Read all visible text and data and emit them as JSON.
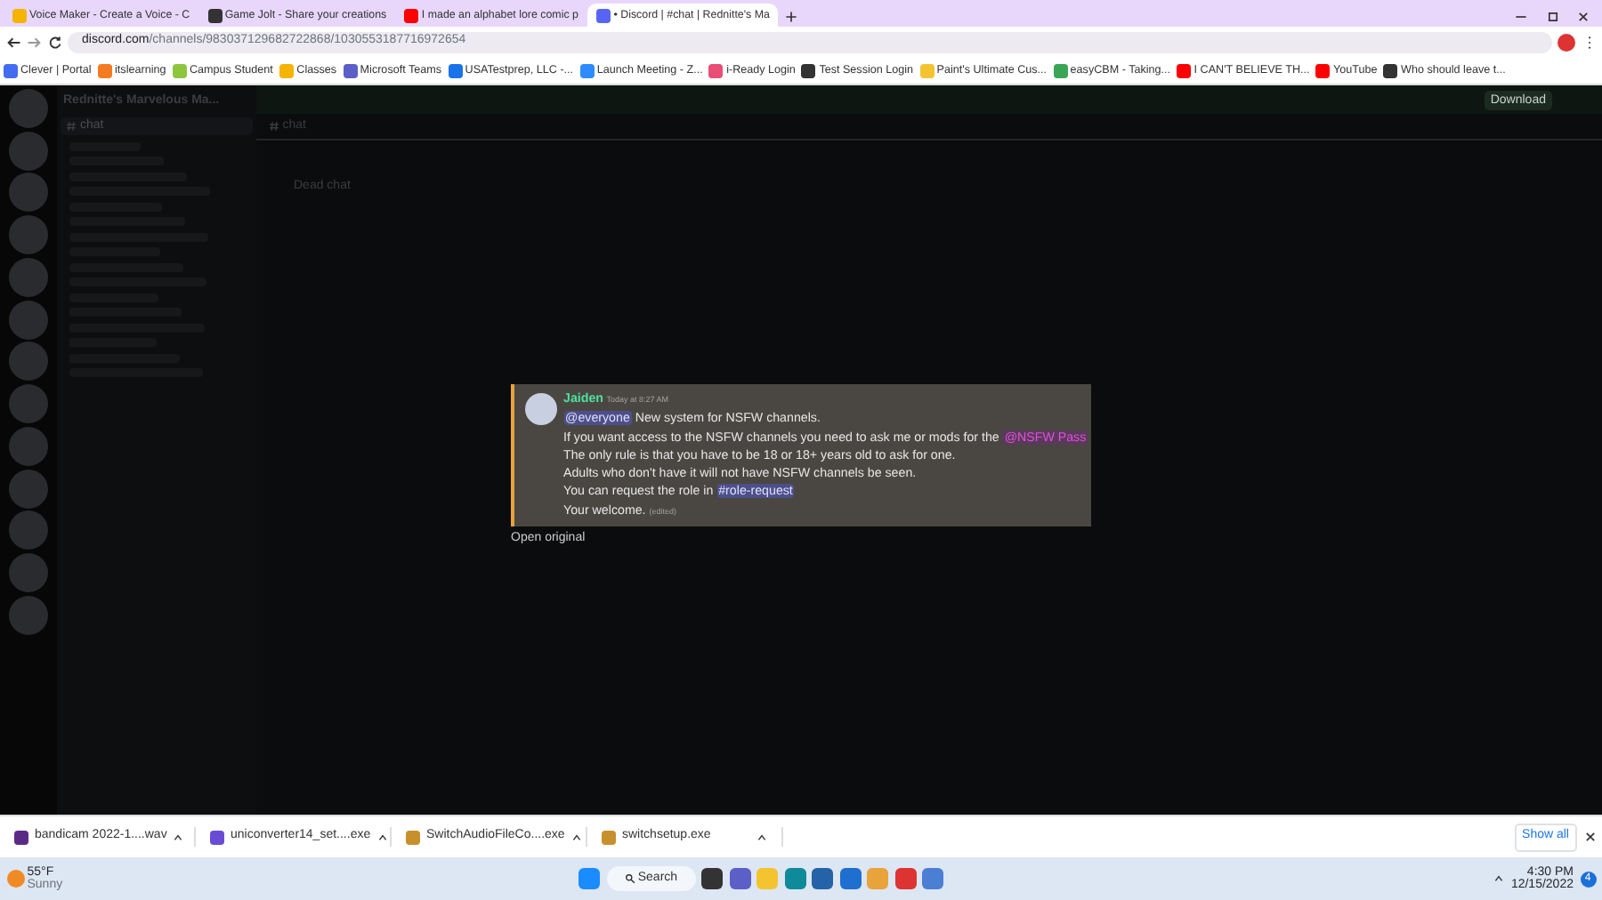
{
  "tabs": [
    {
      "title": "Voice Maker - Create a Voice - C",
      "selected": false,
      "color": "#f4b400"
    },
    {
      "title": "Game Jolt - Share your creations",
      "selected": false,
      "color": "#333333"
    },
    {
      "title": "I made an alphabet lore comic p",
      "selected": false,
      "color": "#ff0000"
    },
    {
      "title": "• Discord | #chat | Rednitte's Ma",
      "selected": true,
      "color": "#5865f2"
    }
  ],
  "address": {
    "host": "discord.com",
    "path": "/channels/983037129682722868/1030553187716972654"
  },
  "bookmarks": [
    {
      "label": "Clever | Portal",
      "color": "#436cf2"
    },
    {
      "label": "itslearning",
      "color": "#f47b20"
    },
    {
      "label": "Campus Student",
      "color": "#8cc63f"
    },
    {
      "label": "Classes",
      "color": "#f4b400"
    },
    {
      "label": "Microsoft Teams",
      "color": "#5b5fc7"
    },
    {
      "label": "USATestprep, LLC -...",
      "color": "#1a73e8"
    },
    {
      "label": "Launch Meeting - Z...",
      "color": "#2d8cff"
    },
    {
      "label": "i-Ready Login",
      "color": "#e94e77"
    },
    {
      "label": "Test Session Login",
      "color": "#333333"
    },
    {
      "label": "Paint's Ultimate Cus...",
      "color": "#f4c430"
    },
    {
      "label": "easyCBM - Taking...",
      "color": "#3aa655"
    },
    {
      "label": "I CAN'T BELIEVE TH...",
      "color": "#ff0000"
    },
    {
      "label": "YouTube",
      "color": "#ff0000"
    },
    {
      "label": "Who should leave t...",
      "color": "#333333"
    }
  ],
  "discord": {
    "download": "Download",
    "server_name": "Rednitte's Marvelous Ma...",
    "channel_header": "chat",
    "channels": [
      {
        "name": "chat",
        "selected": true
      }
    ],
    "messages": [
      "Dead chat"
    ]
  },
  "lightbox": {
    "author": "Jaiden",
    "time": "Today at 8:27 AM",
    "lines": [
      [
        {
          "kind": "mention",
          "text": "@everyone"
        },
        {
          "kind": "text",
          "text": " New system for NSFW channels."
        }
      ],
      [
        {
          "kind": "text",
          "text": "If you want access to the NSFW channels you need to ask me or mods for the "
        },
        {
          "kind": "role",
          "text": "@NSFW Pass"
        }
      ],
      [
        {
          "kind": "text",
          "text": "The only rule is that you have to be 18 or 18+ years old to ask for one."
        }
      ],
      [
        {
          "kind": "text",
          "text": "Adults who don't have it will not have NSFW channels be seen."
        }
      ],
      [
        {
          "kind": "text",
          "text": "You can request the role in "
        },
        {
          "kind": "channel",
          "text": "#role-request"
        }
      ],
      [
        {
          "kind": "text",
          "text": "Your welcome. "
        },
        {
          "kind": "edited",
          "text": "(edited)"
        }
      ]
    ],
    "open_original": "Open original"
  },
  "downloads": [
    {
      "name": "bandicam 2022-1....wav",
      "color": "#5b2a86"
    },
    {
      "name": "uniconverter14_set....exe",
      "color": "#6a4bd6"
    },
    {
      "name": "SwitchAudioFileCo....exe",
      "color": "#c8902c"
    },
    {
      "name": "switchsetup.exe",
      "color": "#c8902c"
    }
  ],
  "show_all": "Show all",
  "taskbar": {
    "temperature": "55°F",
    "weather": "Sunny",
    "search": "Search",
    "time": "4:30 PM",
    "date": "12/15/2022",
    "notifications": "4"
  }
}
